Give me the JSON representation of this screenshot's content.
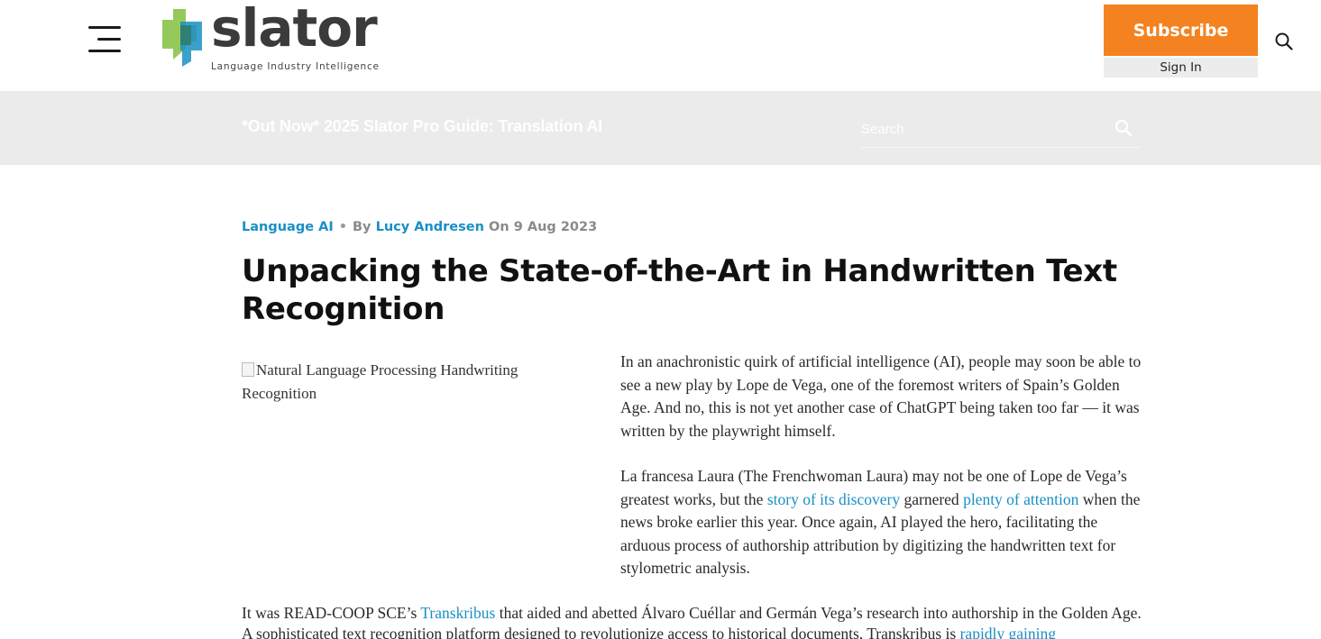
{
  "header": {
    "logo_word": "slator",
    "logo_tagline": "Language Industry Intelligence",
    "subscribe_label": "Subscribe",
    "signin_label": "Sign In"
  },
  "banner": {
    "promo_text": "*Out Now* 2025 Slator Pro Guide: Translation AI",
    "search_placeholder": "Search"
  },
  "article": {
    "category": "Language AI",
    "by_label": "By",
    "author": "Lucy Andresen",
    "on_label": "On",
    "date": "9 Aug 2023",
    "title": "Unpacking the State-of-the-Art in Handwritten Text Recognition",
    "image_alt": "Natural Language Processing Handwriting Recognition",
    "p1": "In an anachronistic quirk of artificial intelligence (AI), people may soon be able to see a new play by Lope de Vega, one of the foremost writers of Spain’s Golden Age. And no, this is not yet another case of ChatGPT being taken too far — it was written by the playwright himself.",
    "p2_a": "La francesa Laura (The Frenchwoman Laura) may not be one of Lope de Vega’s greatest works, but the ",
    "p2_link1": "story of its discovery",
    "p2_b": " garnered ",
    "p2_link2": "plenty of attention",
    "p2_c": " when the news broke earlier this year. Once again, AI played the hero, facilitating the arduous process of authorship attribution by digitizing the handwritten text for stylometric analysis.",
    "p3_a": "It was READ-COOP SCE’s ",
    "p3_link1": "Transkribus",
    "p3_b": " that aided and abetted Álvaro Cuéllar and Germán Vega’s research into authorship in the Golden Age. A sophisticated text recognition platform designed to revolutionize access to historical documents, Transkribus is ",
    "p3_link2": "rapidly gaining"
  },
  "colors": {
    "accent_orange": "#f58220",
    "link_blue": "#1a8fc4",
    "banner_grey": "#ebebeb"
  },
  "icons": [
    "menu-icon",
    "logo-mark",
    "search-icon"
  ]
}
